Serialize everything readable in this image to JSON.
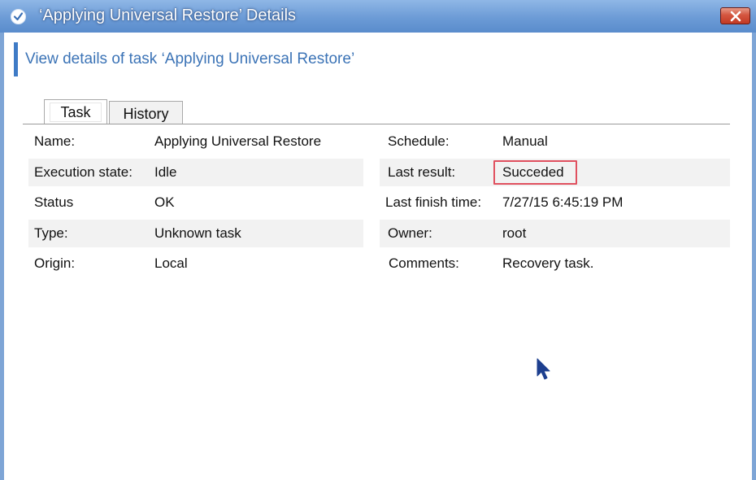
{
  "window": {
    "title": "‘Applying Universal Restore’ Details",
    "app_icon": "checkmark-circle-icon",
    "close_icon": "close-icon"
  },
  "header": {
    "text": "View details of task ‘Applying Universal Restore’"
  },
  "tabs": [
    {
      "label": "Task",
      "selected": true
    },
    {
      "label": "History",
      "selected": false
    }
  ],
  "details": {
    "left": [
      {
        "label": "Name:",
        "value": "Applying Universal Restore"
      },
      {
        "label": "Execution state:",
        "value": "Idle"
      },
      {
        "label": "Status",
        "value": "OK"
      },
      {
        "label": "Type:",
        "value": "Unknown task"
      },
      {
        "label": "Origin:",
        "value": "Local"
      }
    ],
    "right": [
      {
        "label": "Schedule:",
        "value": "Manual"
      },
      {
        "label": "Last result:",
        "value": "Succeded"
      },
      {
        "label": "Last finish time:",
        "value": "7/27/15 6:45:19 PM"
      },
      {
        "label": "Owner:",
        "value": "root"
      },
      {
        "label": "Comments:",
        "value": "Recovery task."
      }
    ]
  },
  "colors": {
    "titlebar": "#6c9bd6",
    "header_text": "#3b73b6",
    "row_shade": "#f2f2f2",
    "highlight_box": "#e0505f",
    "cursor": "#1d3f8f"
  }
}
